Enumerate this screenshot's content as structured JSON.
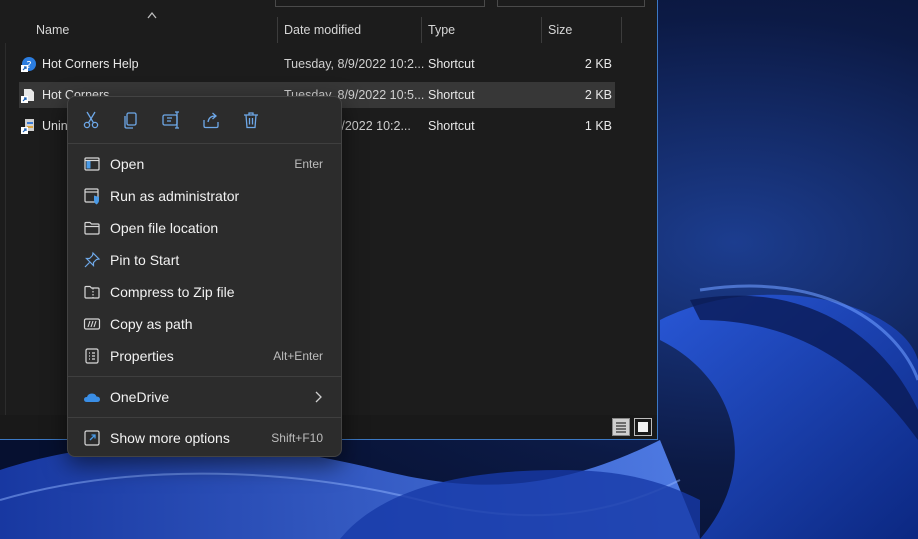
{
  "explorer": {
    "columns": {
      "name": "Name",
      "date_modified": "Date modified",
      "type": "Type",
      "size": "Size"
    },
    "files": [
      {
        "name": "Hot Corners Help",
        "date": "Tuesday, 8/9/2022 10:2...",
        "type": "Shortcut",
        "size": "2 KB",
        "icon": "help-shortcut-icon"
      },
      {
        "name": "Hot Corners",
        "date": "Tuesday, 8/9/2022 10:5...",
        "type": "Shortcut",
        "size": "2 KB",
        "icon": "shortcut-icon",
        "selected": true
      },
      {
        "name": "Unin",
        "date": "8/9/2022 10:2...",
        "type": "Shortcut",
        "size": "1 KB",
        "icon": "uninstall-icon"
      }
    ],
    "accent": "#3b78c4"
  },
  "context_menu": {
    "quick_actions": [
      {
        "name": "cut",
        "icon": "scissors-icon"
      },
      {
        "name": "copy",
        "icon": "copy-icon"
      },
      {
        "name": "rename",
        "icon": "rename-icon"
      },
      {
        "name": "share",
        "icon": "share-icon"
      },
      {
        "name": "delete",
        "icon": "trash-icon"
      }
    ],
    "items": [
      {
        "label": "Open",
        "shortcut": "Enter",
        "icon": "open-icon"
      },
      {
        "label": "Run as administrator",
        "shortcut": "",
        "icon": "shield-run-icon"
      },
      {
        "label": "Open file location",
        "shortcut": "",
        "icon": "folder-icon"
      },
      {
        "label": "Pin to Start",
        "shortcut": "",
        "icon": "pin-icon"
      },
      {
        "label": "Compress to Zip file",
        "shortcut": "",
        "icon": "zip-folder-icon"
      },
      {
        "label": "Copy as path",
        "shortcut": "",
        "icon": "copy-path-icon"
      },
      {
        "label": "Properties",
        "shortcut": "Alt+Enter",
        "icon": "properties-icon"
      },
      {
        "label": "OneDrive",
        "shortcut": "",
        "icon": "onedrive-icon",
        "submenu": true
      },
      {
        "label": "Show more options",
        "shortcut": "Shift+F10",
        "icon": "show-more-icon"
      }
    ]
  }
}
